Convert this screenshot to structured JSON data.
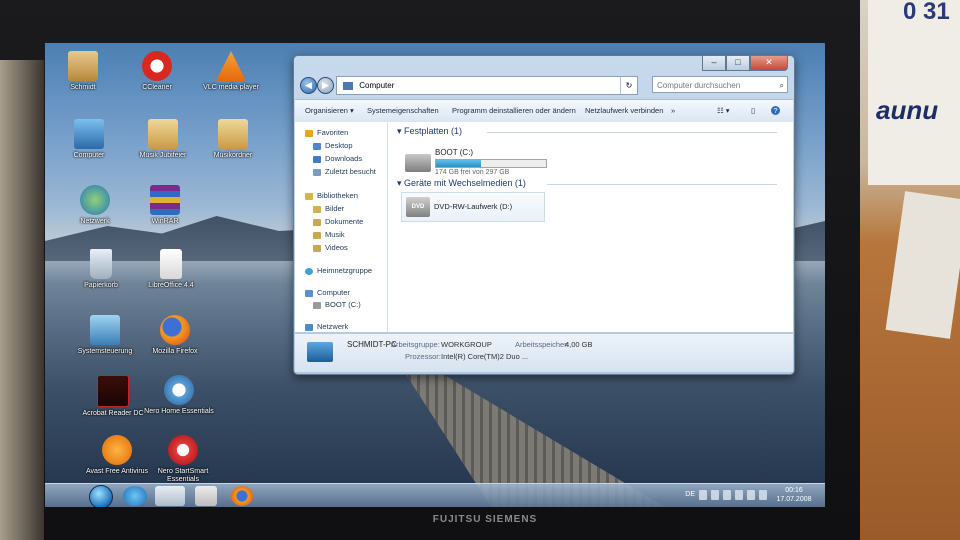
{
  "photo": {
    "sign_text_top": "0 31",
    "sign_text_main": "aunu",
    "monitor_brand": "FUJITSU SIEMENS"
  },
  "desktop": {
    "icons": [
      {
        "label": "Schmidt",
        "icon": "user-folder-icon"
      },
      {
        "label": "CCleaner",
        "icon": "ccleaner-icon"
      },
      {
        "label": "VLC media player",
        "icon": "vlc-icon"
      },
      {
        "label": "Computer",
        "icon": "computer-icon"
      },
      {
        "label": "Musik Jubifeier",
        "icon": "folder-icon"
      },
      {
        "label": "Musikordner",
        "icon": "folder-icon"
      },
      {
        "label": "Netzwerk",
        "icon": "network-icon"
      },
      {
        "label": "WinRAR",
        "icon": "winrar-icon"
      },
      {
        "label": "Papierkorb",
        "icon": "recycle-bin-icon"
      },
      {
        "label": "LibreOffice 4.4",
        "icon": "libreoffice-icon"
      },
      {
        "label": "Systemsteuerung",
        "icon": "control-panel-icon"
      },
      {
        "label": "Mozilla Firefox",
        "icon": "firefox-icon"
      },
      {
        "label": "Acrobat Reader DC",
        "icon": "acrobat-icon"
      },
      {
        "label": "Nero Home Essentials",
        "icon": "nero-home-icon"
      },
      {
        "label": "Avast Free Antivirus",
        "icon": "avast-icon"
      },
      {
        "label": "Nero StartSmart Essentials",
        "icon": "nero-startsmart-icon"
      }
    ]
  },
  "explorer": {
    "address": "Computer",
    "search_placeholder": "Computer durchsuchen",
    "toolbar": {
      "organize": "Organisieren ▾",
      "system_properties": "Systemeigenschaften",
      "uninstall": "Programm deinstallieren oder ändern",
      "map_drive": "Netzlaufwerk verbinden",
      "more": "»"
    },
    "navpane": {
      "favorites": "Favoriten",
      "desktop": "Desktop",
      "downloads": "Downloads",
      "recent": "Zuletzt besucht",
      "libraries": "Bibliotheken",
      "pictures": "Bilder",
      "documents": "Dokumente",
      "music": "Musik",
      "videos": "Videos",
      "homegroup": "Heimnetzgruppe",
      "computer": "Computer",
      "boot": "BOOT (C:)",
      "network": "Netzwerk"
    },
    "groups": {
      "hard_disks": "Festplatten (1)",
      "removable": "Geräte mit Wechselmedien (1)"
    },
    "drive_c": {
      "name": "BOOT (C:)",
      "free_text": "174 GB frei von 297 GB",
      "used_fraction": 0.41
    },
    "dvd": {
      "name": "DVD-RW-Laufwerk (D:)",
      "badge": "DVD"
    },
    "details": {
      "pc_name": "SCHMIDT-PC",
      "workgroup_label": "Arbeitsgruppe:",
      "workgroup_value": "WORKGROUP",
      "memory_label": "Arbeitsspeicher:",
      "memory_value": "4,00 GB",
      "processor_label": "Prozessor:",
      "processor_value": "Intel(R) Core(TM)2 Duo ..."
    }
  },
  "taskbar": {
    "language": "DE",
    "time": "00:16",
    "date": "17.07.2008"
  }
}
